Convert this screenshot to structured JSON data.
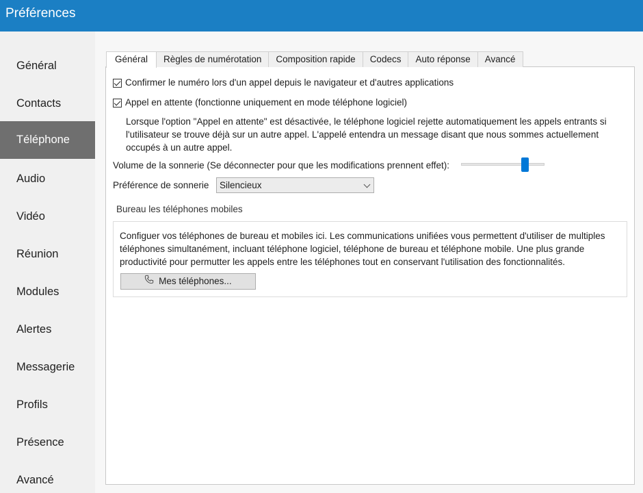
{
  "window": {
    "title": "Préférences"
  },
  "sidebar": {
    "items": [
      {
        "label": "Général"
      },
      {
        "label": "Contacts"
      },
      {
        "label": "Téléphone",
        "active": true
      },
      {
        "label": "Audio"
      },
      {
        "label": "Vidéo"
      },
      {
        "label": "Réunion"
      },
      {
        "label": "Modules"
      },
      {
        "label": "Alertes"
      },
      {
        "label": "Messagerie"
      },
      {
        "label": "Profils"
      },
      {
        "label": "Présence"
      },
      {
        "label": "Avancé"
      }
    ]
  },
  "tabs": [
    {
      "label": "Général",
      "active": true
    },
    {
      "label": "Règles de numérotation"
    },
    {
      "label": "Composition rapide"
    },
    {
      "label": "Codecs"
    },
    {
      "label": "Auto réponse"
    },
    {
      "label": "Avancé"
    }
  ],
  "general": {
    "confirm_number": {
      "label": "Confirmer le numéro lors d'un appel depuis le navigateur et d'autres applications",
      "checked": true
    },
    "call_waiting": {
      "label": "Appel en attente (fonctionne uniquement en mode téléphone logiciel)",
      "checked": true
    },
    "call_waiting_desc": "Lorsque l'option  \"Appel en attente\" est désactivée, le téléphone logiciel rejette automatiquement les appels entrants si l'utilisateur se trouve déjà sur un autre appel. L'appelé entendra un message disant que nous sommes actuellement occupés à un autre appel.",
    "ring_volume": {
      "label": "Volume de la sonnerie (Se déconnecter pour que  les modifications prennent effet):",
      "level": 0.77
    },
    "ring_preference": {
      "label": "Préférence de sonnerie",
      "value": "Silencieux"
    }
  },
  "desk_mobile": {
    "group_label": "Bureau les téléphones mobiles",
    "description": "Configuer vos téléphones de bureau et mobiles ici. Les communications unifiées vous permettent d'utiliser de multiples téléphones simultanément, incluant téléphone logiciel, téléphone de bureau et téléphone mobile. Une plus grande productivité pour permutter les appels entre les téléphones tout en conservant l'utilisation des fonctionnalités.",
    "button_label": "Mes téléphones...",
    "button_icon": "phone-icon"
  },
  "colors": {
    "titlebar": "#1b7fc4",
    "active_sidebar": "#6f6f6f",
    "slider_thumb": "#0078d7"
  }
}
